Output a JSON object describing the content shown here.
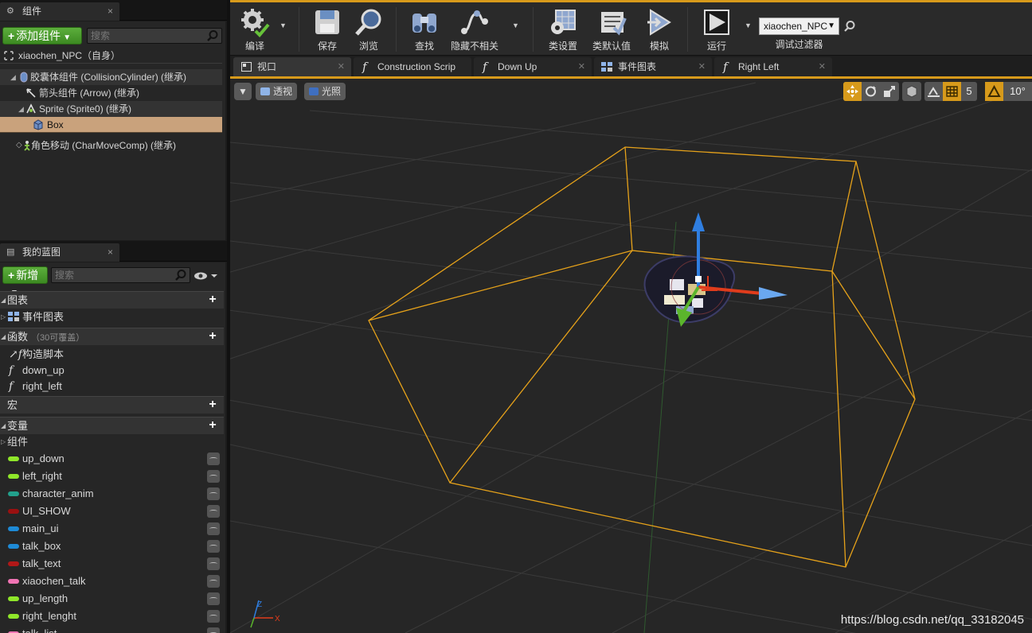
{
  "components_panel": {
    "tab_title": "组件",
    "add_button": "添加组件",
    "search_placeholder": "搜索",
    "root": "xiaochen_NPC（自身）",
    "items": [
      "胶囊体组件 (CollisionCylinder) (继承)",
      "箭头组件 (Arrow) (继承)",
      "Sprite (Sprite0) (继承)",
      "Box",
      "角色移动 (CharMoveComp) (继承)"
    ]
  },
  "my_blueprint": {
    "tab_title": "我的蓝图",
    "new_button": "新增",
    "search_placeholder": "搜索",
    "graphs_header": "图表",
    "event_graph": "事件图表",
    "functions_header": "函数",
    "functions_sub": "（30可覆盖）",
    "functions": [
      "构造脚本",
      "down_up",
      "right_left"
    ],
    "macros_header": "宏",
    "variables_header": "变量",
    "components_group": "组件",
    "variables": [
      {
        "name": "up_down",
        "color": "#8fe62a"
      },
      {
        "name": "left_right",
        "color": "#8fe62a"
      },
      {
        "name": "character_anim",
        "color": "#22a08c"
      },
      {
        "name": "UI_SHOW",
        "color": "#9a1010"
      },
      {
        "name": "main_ui",
        "color": "#1e8ad6"
      },
      {
        "name": "talk_box",
        "color": "#1e8ad6"
      },
      {
        "name": "talk_text",
        "color": "#b01818"
      },
      {
        "name": "xiaochen_talk",
        "color": "#f074b4"
      },
      {
        "name": "up_length",
        "color": "#8fe62a"
      },
      {
        "name": "right_lenght",
        "color": "#8fe62a"
      },
      {
        "name": "talk_list",
        "color": "#f074b4"
      }
    ]
  },
  "toolbar": {
    "compile": "编译",
    "save": "保存",
    "browse": "浏览",
    "find": "查找",
    "hide_unrelated": "隐藏不相关",
    "class_settings": "类设置",
    "class_defaults": "类默认值",
    "simulate": "模拟",
    "play": "运行",
    "debug_object": "xiaochen_NPC",
    "debug_filter": "调试过滤器"
  },
  "doc_tabs": [
    {
      "label": "视口",
      "icon": "viewport-icon"
    },
    {
      "label": "Construction Scrip",
      "icon": "function-icon"
    },
    {
      "label": "Down Up",
      "icon": "function-icon"
    },
    {
      "label": "事件图表",
      "icon": "event-graph-icon"
    },
    {
      "label": "Right Left",
      "icon": "function-icon"
    }
  ],
  "viewport": {
    "perspective": "透视",
    "lit": "光照",
    "grid_snap": "5",
    "rotation_snap": "10°",
    "axis_x": "X",
    "axis_z": "Z"
  },
  "watermark": "https://blog.csdn.net/qq_33182045",
  "colors": {
    "accent": "#d79a1b",
    "selection": "#c9a27c",
    "box_wire": "#e6a21a",
    "gizmo_x": "#e03c1c",
    "gizmo_y": "#5bb52c",
    "gizmo_z": "#2f7ee0"
  }
}
